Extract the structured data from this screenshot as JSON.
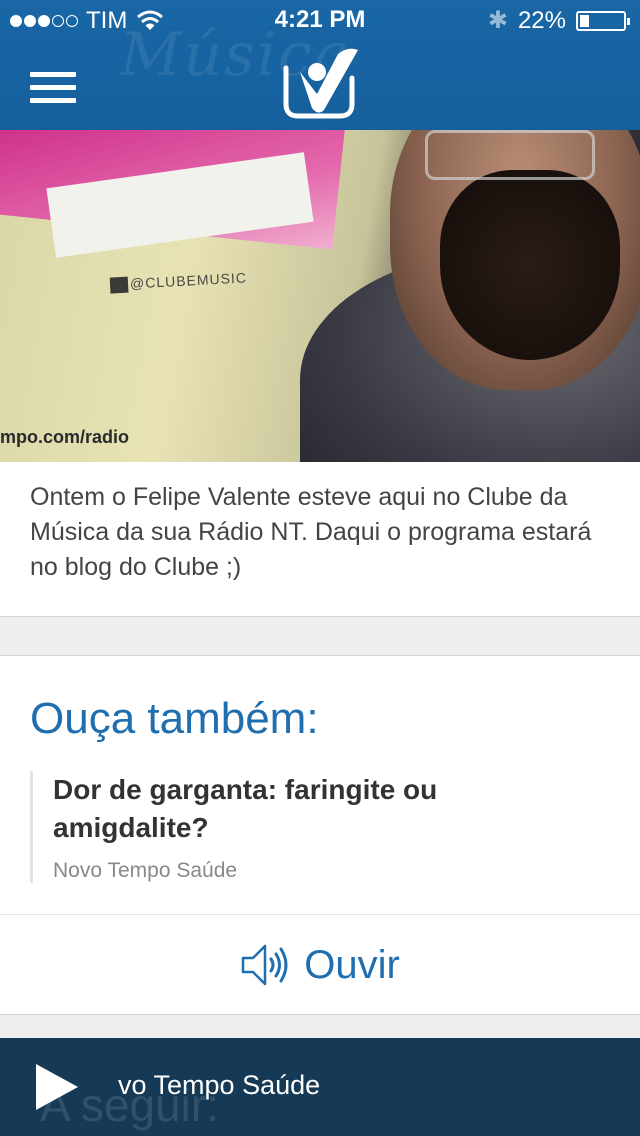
{
  "status_bar": {
    "carrier": "TIM",
    "time": "4:21 PM",
    "battery": "22%",
    "battery_level": 0.22,
    "signal_bars": 3,
    "signal_total": 5
  },
  "header": {
    "menu_icon": "hamburger-icon",
    "logo_icon": "novo-tempo-logo",
    "bg_color": "#1a67a6"
  },
  "hero": {
    "sticker_text": "@CLUBEMUSIC",
    "url_text": "mpo.com/radio",
    "background_text": "Música"
  },
  "post": {
    "caption": "Ontem o Felipe Valente esteve aqui no Clube da Música da sua Rádio NT. Daqui o programa estará no blog do Clube ;)"
  },
  "also_listen": {
    "heading": "Ouça também:",
    "item_title": "Dor de garganta: faringite ou amigdalite?",
    "item_program": "Novo Tempo Saúde",
    "button_label": "Ouvir",
    "button_icon": "speaker-icon",
    "accent_color": "#1f6fb0"
  },
  "player": {
    "now_playing": "vo Tempo Saúde",
    "background_label": "A seguir:",
    "play_icon": "play-icon",
    "bg_color": "#163a55"
  }
}
